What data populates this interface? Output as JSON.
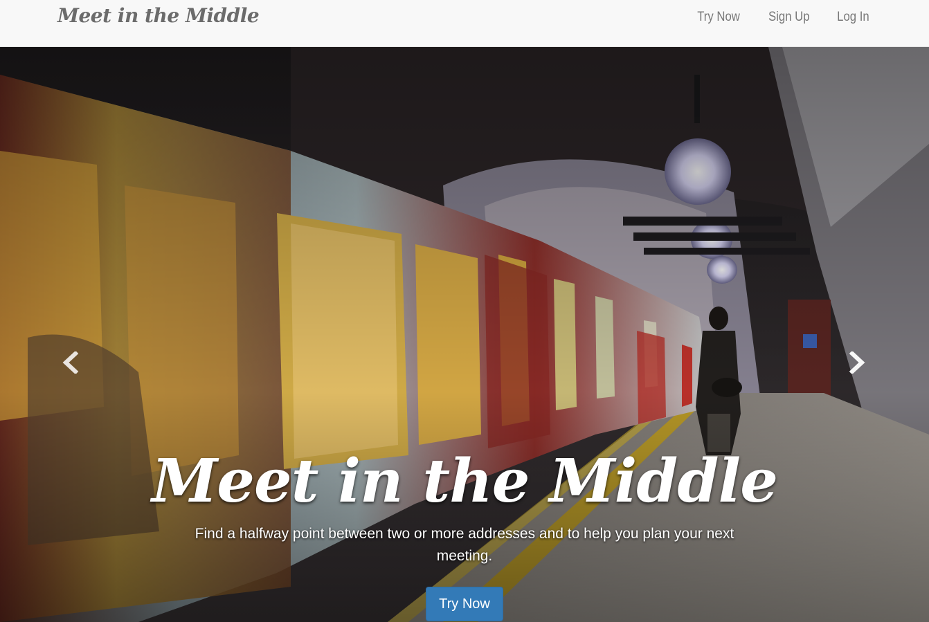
{
  "navbar": {
    "brand": "Meet in the Middle",
    "links": [
      "Try Now",
      "Sign Up",
      "Log In"
    ],
    "background": "#f8f8f8",
    "link_color": "#777777"
  },
  "hero": {
    "title": "Meet in the Middle",
    "subtitle": "Find a halfway point between two or more addresses and to help you plan your next meeting.",
    "cta_label": "Try Now",
    "cta_color": "#337ab7",
    "prev_icon": "chevron-left-icon",
    "next_icon": "chevron-right-icon",
    "background_image": "subway train at platform photo"
  }
}
